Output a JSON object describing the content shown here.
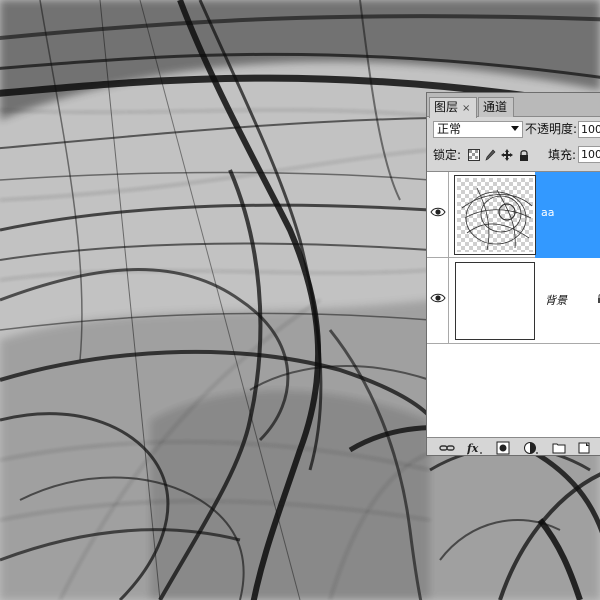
{
  "canvas": {
    "background_color": "#bfbfbf",
    "stroke_color": "#111111",
    "description_icon": "fractal-flame-artwork"
  },
  "layers_panel": {
    "tabs": [
      {
        "label": "图层",
        "close": "×"
      },
      {
        "label": "通道"
      }
    ],
    "blend_mode": "正常",
    "opacity_label": "不透明度:",
    "opacity_value": "100",
    "lock_label": "锁定:",
    "lock_icons": [
      "lock-transparent-pixels-icon",
      "lock-image-pixels-icon",
      "lock-position-icon",
      "lock-all-icon"
    ],
    "fill_label": "填充:",
    "fill_value": "100",
    "layers": [
      {
        "name": "aa",
        "visible": true,
        "selected": true,
        "thumbnail": "fractal-transparent"
      },
      {
        "name": "背景",
        "visible": true,
        "selected": false,
        "thumbnail": "white",
        "locked": true
      }
    ],
    "footer_icons": [
      "link-layers-icon",
      "layer-style-fx-icon",
      "add-mask-icon",
      "adjustment-layer-icon",
      "new-group-icon",
      "new-layer-icon"
    ],
    "colors": {
      "selection": "#3399ff",
      "panel_bg": "#d6d6d6"
    }
  }
}
